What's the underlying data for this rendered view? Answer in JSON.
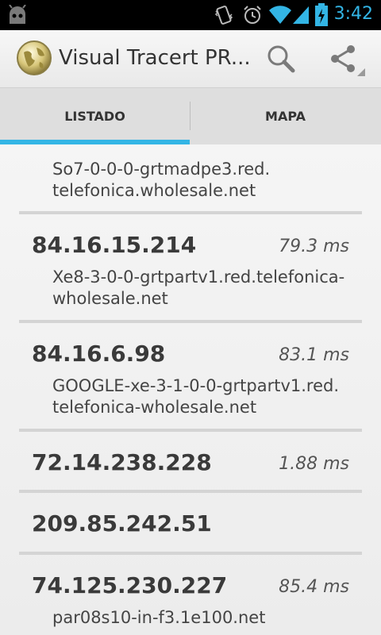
{
  "status_bar": {
    "time": "3:42",
    "icons": [
      "android-icon",
      "vibrate-icon",
      "alarm-icon",
      "wifi-icon",
      "signal-icon",
      "battery-charging-icon"
    ]
  },
  "action_bar": {
    "title": "Visual Tracert PR...",
    "icons": [
      "app-globe-icon",
      "search-icon",
      "share-icon"
    ]
  },
  "tabs": [
    {
      "label": "LISTADO",
      "selected": true
    },
    {
      "label": "MAPA",
      "selected": false
    }
  ],
  "accent_color": "#33b5e5",
  "hops": [
    {
      "ip": "",
      "time": "",
      "host": "So7-0-0-0-grtmadpe3.red.\ntelefonica.wholesale.net"
    },
    {
      "ip": "84.16.15.214",
      "time": "79.3 ms",
      "host": "Xe8-3-0-0-grtpartv1.red.telefonica-\nwholesale.net"
    },
    {
      "ip": "84.16.6.98",
      "time": "83.1 ms",
      "host": "GOOGLE-xe-3-1-0-0-grtpartv1.red.\ntelefonica-wholesale.net"
    },
    {
      "ip": "72.14.238.228",
      "time": "1.88 ms",
      "host": ""
    },
    {
      "ip": "209.85.242.51",
      "time": "",
      "host": ""
    },
    {
      "ip": "74.125.230.227",
      "time": "85.4 ms",
      "host": "par08s10-in-f3.1e100.net"
    }
  ]
}
